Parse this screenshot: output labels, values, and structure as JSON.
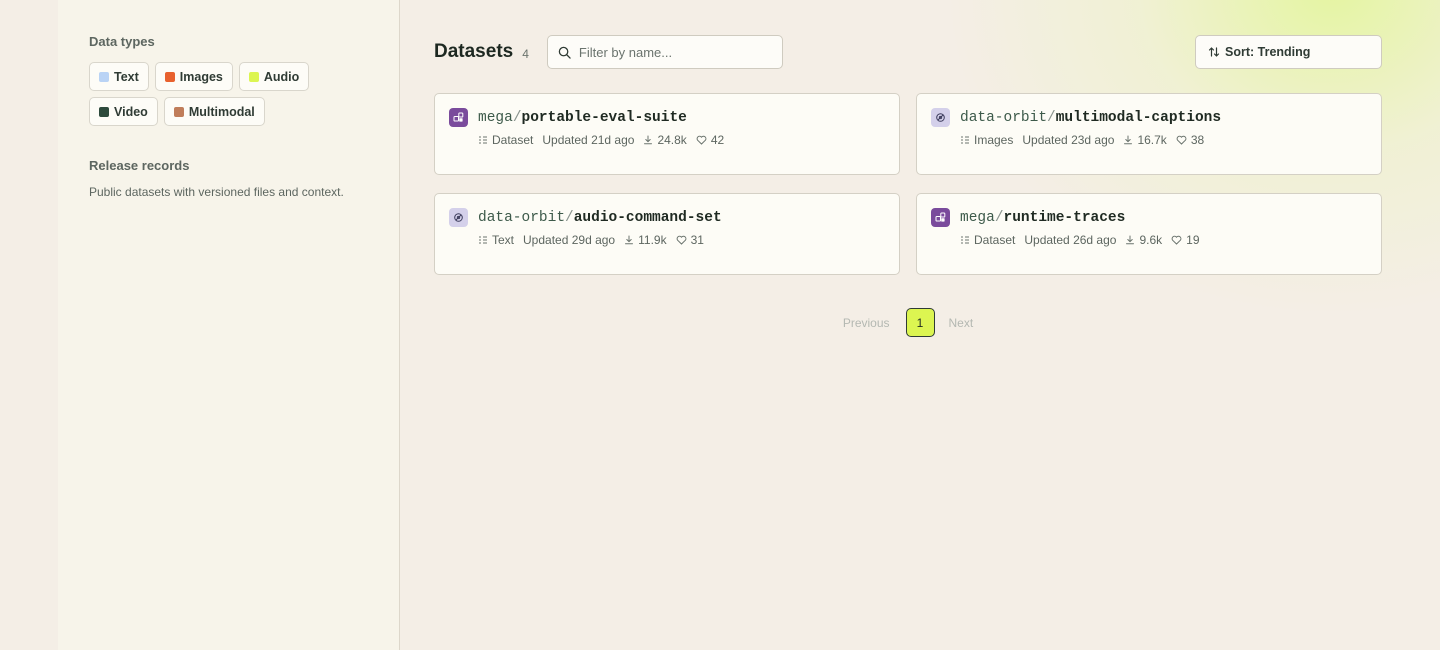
{
  "sidebar": {
    "data_types_title": "Data types",
    "data_types": [
      {
        "label": "Text",
        "color": "#b9d3f5"
      },
      {
        "label": "Images",
        "color": "#e8612e"
      },
      {
        "label": "Audio",
        "color": "#dcf551"
      },
      {
        "label": "Video",
        "color": "#2d4a3c"
      },
      {
        "label": "Multimodal",
        "color": "#c07d5a"
      }
    ],
    "release_title": "Release records",
    "release_desc": "Public datasets with versioned files and context."
  },
  "main": {
    "title": "Datasets",
    "count": "4",
    "search_placeholder": "Filter by name...",
    "sort_label": "Sort: Trending",
    "datasets": [
      {
        "owner": "mega",
        "sep": "/",
        "name": "portable-eval-suite",
        "type": "Dataset",
        "updated": "Updated 21d ago",
        "downloads": "24.8k",
        "likes": "42",
        "org_icon": "mega-org-icon"
      },
      {
        "owner": "data-orbit",
        "sep": "/",
        "name": "multimodal-captions",
        "type": "Images",
        "updated": "Updated 23d ago",
        "downloads": "16.7k",
        "likes": "38",
        "org_icon": "orbit-org-icon"
      },
      {
        "owner": "data-orbit",
        "sep": "/",
        "name": "audio-command-set",
        "type": "Text",
        "updated": "Updated 29d ago",
        "downloads": "11.9k",
        "likes": "31",
        "org_icon": "orbit-org-icon"
      },
      {
        "owner": "mega",
        "sep": "/",
        "name": "runtime-traces",
        "type": "Dataset",
        "updated": "Updated 26d ago",
        "downloads": "9.6k",
        "likes": "19",
        "org_icon": "mega-org-icon"
      }
    ],
    "pagination": {
      "previous": "Previous",
      "current": "1",
      "next": "Next"
    }
  }
}
